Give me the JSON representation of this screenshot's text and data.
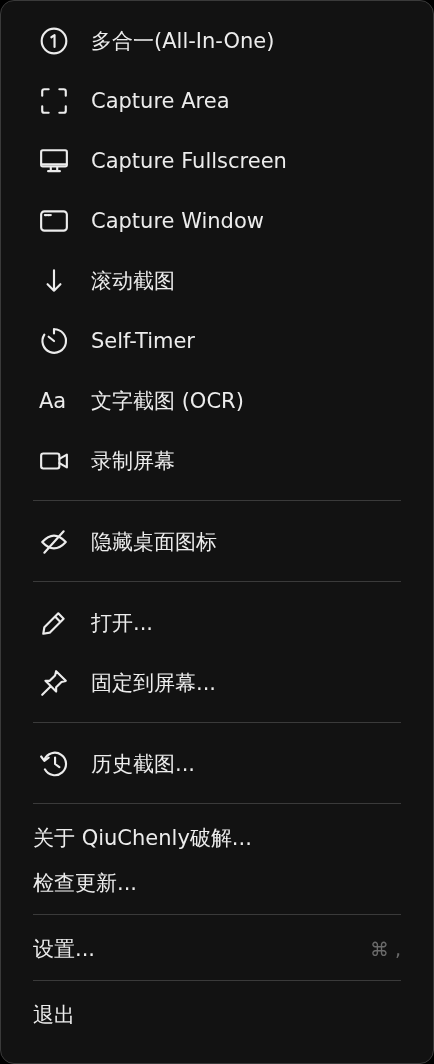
{
  "menu": {
    "sections": [
      {
        "items": [
          {
            "kind": "icon",
            "label": "多合一(All-In-One)"
          },
          {
            "kind": "icon",
            "label": "Capture Area"
          },
          {
            "kind": "icon",
            "label": "Capture Fullscreen"
          },
          {
            "kind": "icon",
            "label": "Capture Window"
          },
          {
            "kind": "icon",
            "label": "滚动截图"
          },
          {
            "kind": "icon",
            "label": "Self-Timer"
          },
          {
            "kind": "glyph",
            "glyph": "Aa",
            "label": "文字截图 (OCR)"
          },
          {
            "kind": "icon",
            "label": "录制屏幕"
          }
        ]
      },
      {
        "items": [
          {
            "kind": "icon",
            "label": "隐藏桌面图标"
          }
        ]
      },
      {
        "items": [
          {
            "kind": "icon",
            "label": "打开..."
          },
          {
            "kind": "icon",
            "label": "固定到屏幕..."
          }
        ]
      },
      {
        "items": [
          {
            "kind": "icon",
            "label": "历史截图..."
          }
        ]
      },
      {
        "items": [
          {
            "kind": "plain",
            "label": "关于 QiuChenly破解..."
          },
          {
            "kind": "plain",
            "label": "检查更新..."
          }
        ]
      },
      {
        "items": [
          {
            "kind": "plain",
            "label": "设置...",
            "shortcut": "⌘ ,"
          }
        ]
      },
      {
        "items": [
          {
            "kind": "plain",
            "label": "退出"
          }
        ]
      }
    ]
  }
}
